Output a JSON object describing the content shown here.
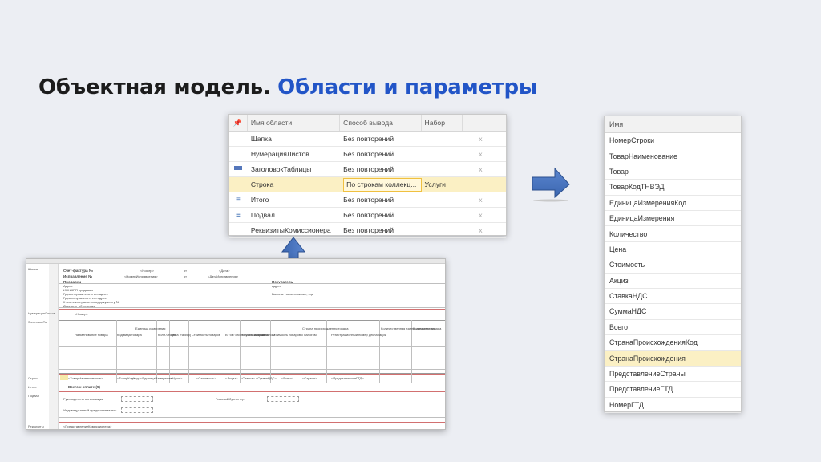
{
  "slide": {
    "title_main": "Объектная модель.",
    "title_accent": "Области и параметры"
  },
  "areas_table": {
    "columns": [
      "Имя области",
      "Способ вывода",
      "Набор"
    ],
    "rows": [
      {
        "icon": "none",
        "name": "Шапка",
        "mode": "Без повторений",
        "set": "",
        "x": "x"
      },
      {
        "icon": "none",
        "name": "НумерацияЛистов",
        "mode": "Без повторений",
        "set": "",
        "x": "x"
      },
      {
        "icon": "lines-icon",
        "name": "ЗаголовокТаблицы",
        "mode": "Без повторений",
        "set": "",
        "x": "x"
      },
      {
        "icon": "none",
        "name": "Строка",
        "mode": "По строкам коллекц...",
        "set": "Услуги",
        "x": "",
        "selected": true
      },
      {
        "icon": "sum-icon",
        "name": "Итого",
        "mode": "Без повторений",
        "set": "",
        "x": "x"
      },
      {
        "icon": "sum-icon",
        "name": "Подвал",
        "mode": "Без повторений",
        "set": "",
        "x": "x"
      },
      {
        "icon": "none",
        "name": "РеквизитыКомиссионера",
        "mode": "Без повторений",
        "set": "",
        "x": "x"
      }
    ]
  },
  "names_list": {
    "header": "Имя",
    "items": [
      "НомерСтроки",
      "ТоварНаименование",
      "Товар",
      "ТоварКодТНВЭД",
      "ЕдиницаИзмеренияКод",
      "ЕдиницаИзмерения",
      "Количество",
      "Цена",
      "Стоимость",
      "Акциз",
      "СтавкаНДС",
      "СуммаНДС",
      "Всего",
      "СтранаПроисхожденияКод",
      "СтранаПроисхождения",
      "ПредставлениеСтраны",
      "ПредставлениеГТД",
      "НомерГТД"
    ],
    "selected_index": 14
  },
  "sheet": {
    "area_labels": [
      "Шапка",
      "НумерацияЛистов",
      "ЗаголовокТа",
      "Строка",
      "Итого",
      "Подвал",
      "Реквизиты"
    ],
    "header_texts": {
      "invoice": "Счет-фактура №",
      "correction": "Исправление №",
      "number": "<Номер>",
      "correction_number": "<НомерИсправления>",
      "from": "от",
      "date": "<Дата>",
      "correction_date": "<ДатаИсправления>",
      "seller": "Продавец",
      "address": "Адрес",
      "inn": "ИНН/КПП продавца",
      "shipper": "Грузоотправитель и его адрес",
      "consignee": "Грузополучатель и его адрес",
      "payment_doc": "К платежно-расчетному документу №",
      "shipping_doc": "Документ об отгрузке",
      "buyer": "Покупатель",
      "currency": "Валюта: наименование, код",
      "pagenum": "<Номер>",
      "total_label": "Всего к оплате (9)",
      "head_of_org": "Руководитель организации",
      "chief_accountant": "Главный бухгалтер",
      "entrepreneur": "Индивидуальный предприниматель",
      "commissioner": "<ПредставлениеКомиссионера>"
    },
    "col_headers": [
      "Наименование товара",
      "Код вида товара",
      "Единица измерения",
      "Коли-чество",
      "Цена (тариф)",
      "Стоимость товаров",
      "В том числе сумма акциза",
      "Нало-говая ставка",
      "Сумма налога",
      "Стоимость товаров с налогом",
      "Страна происхождения товара",
      "Регистрационный номер декларации",
      "Количественная единица измерения",
      "Количество товара"
    ],
    "row_values": [
      "<ТоварНаименование>",
      "<ТоварКод>",
      "<Код>",
      "<ЕдиницаИзмерения>",
      "<Цена>",
      "<Стоимость>",
      "<Акциз>",
      "<Ставка>",
      "<СуммаНДС>",
      "<Всего>",
      "<Страна>",
      "<ПредставлениеГТД>"
    ]
  }
}
